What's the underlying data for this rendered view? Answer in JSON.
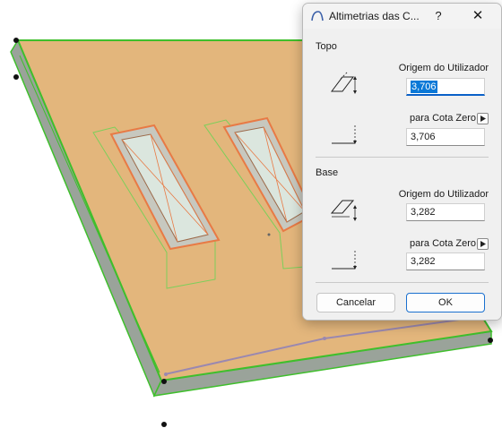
{
  "dialog": {
    "title": "Altimetrias das C...",
    "help_label": "?",
    "close_label": "✕",
    "top_section": {
      "label": "Topo",
      "origin_label": "Origem do Utilizador",
      "origin_value": "3,706",
      "zero_label": "para Cota Zero",
      "zero_value": "3,706"
    },
    "base_section": {
      "label": "Base",
      "origin_label": "Origem do Utilizador",
      "origin_value": "3,282",
      "zero_label": "para Cota Zero",
      "zero_value": "3,282"
    },
    "cancel_label": "Cancelar",
    "ok_label": "OK"
  },
  "colors": {
    "slab_top": "#e3b67c",
    "slab_edge": "#9aa39a",
    "selection_green": "#3fbf2c",
    "window_outline": "#e87a45",
    "accent_blue": "#0a78d7"
  }
}
